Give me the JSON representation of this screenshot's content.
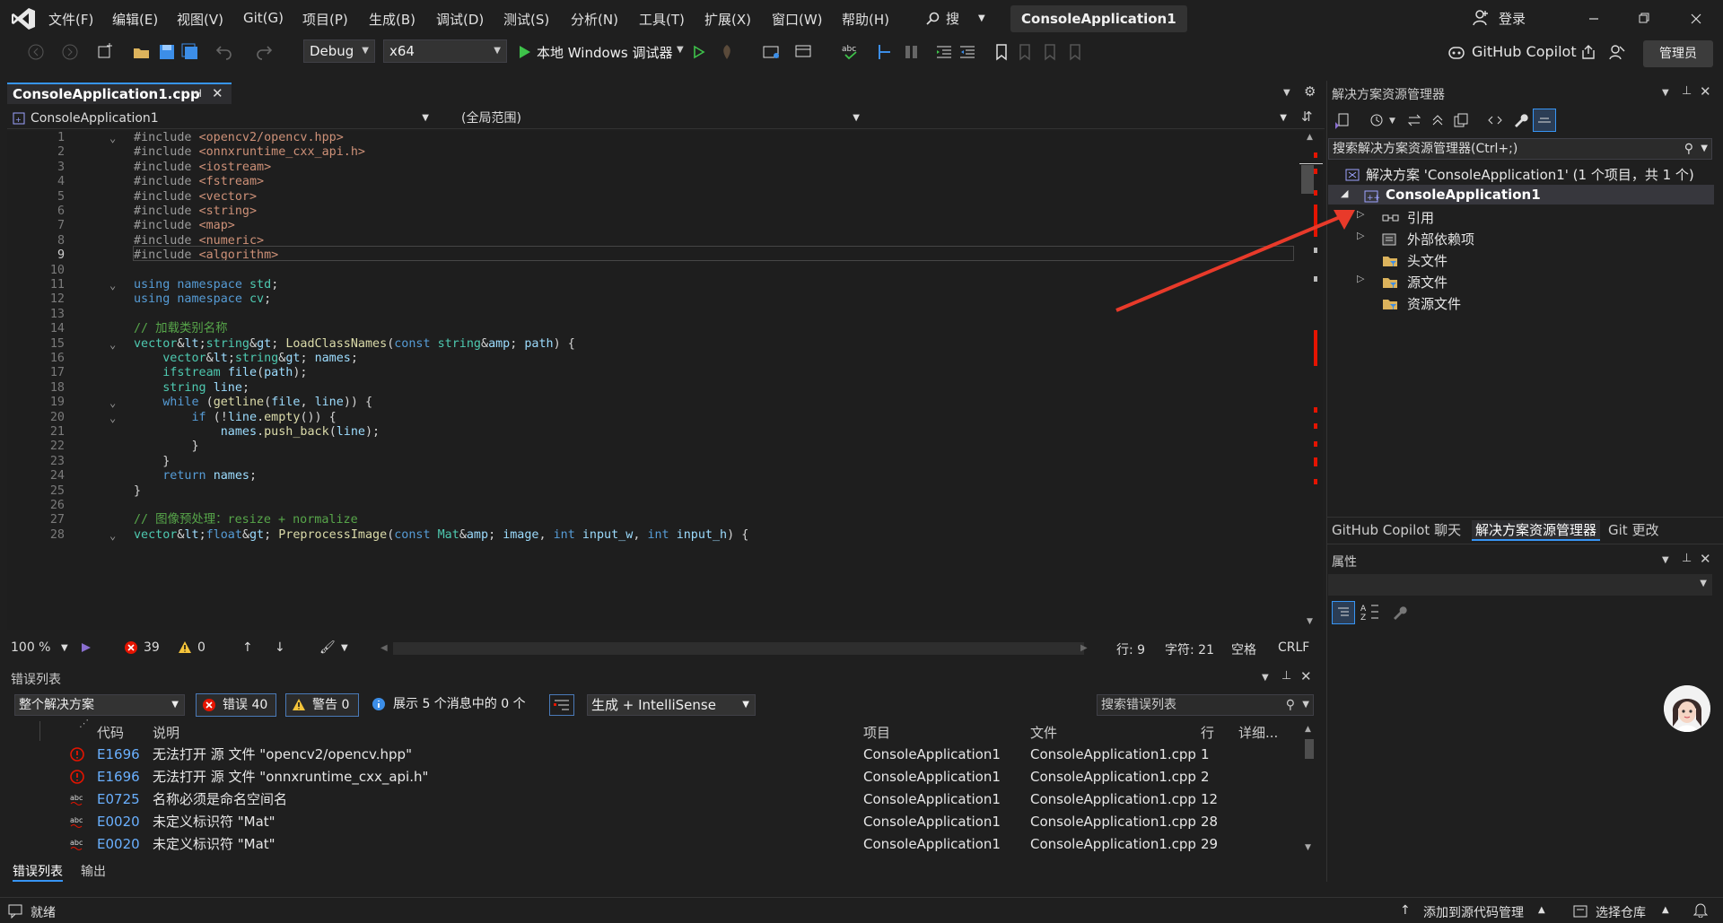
{
  "app": {
    "title": "ConsoleApplication1",
    "search_label": "搜索",
    "login_label": "登录"
  },
  "menu": [
    "文件(F)",
    "编辑(E)",
    "视图(V)",
    "Git(G)",
    "项目(P)",
    "生成(B)",
    "调试(D)",
    "测试(S)",
    "分析(N)",
    "工具(T)",
    "扩展(X)",
    "窗口(W)",
    "帮助(H)"
  ],
  "toolbar": {
    "config": "Debug",
    "platform": "x64",
    "run_label": "本地 Windows 调试器",
    "copilot_label": "GitHub Copilot",
    "admin_label": "管理员"
  },
  "editor": {
    "tab_label": "ConsoleApplication1.cpp",
    "nav_project": "ConsoleApplication1",
    "nav_scope": "(全局范围)",
    "current_line": 9,
    "lines": [
      {
        "n": "1",
        "t": "#include <opencv2/opencv.hpp>"
      },
      {
        "n": "2",
        "t": "#include <onnxruntime_cxx_api.h>"
      },
      {
        "n": "3",
        "t": "#include <iostream>"
      },
      {
        "n": "4",
        "t": "#include <fstream>"
      },
      {
        "n": "5",
        "t": "#include <vector>"
      },
      {
        "n": "6",
        "t": "#include <string>"
      },
      {
        "n": "7",
        "t": "#include <map>"
      },
      {
        "n": "8",
        "t": "#include <numeric>"
      },
      {
        "n": "9",
        "t": "#include <algorithm>"
      },
      {
        "n": "10",
        "t": ""
      },
      {
        "n": "11",
        "t": "using namespace std;"
      },
      {
        "n": "12",
        "t": "using namespace cv;"
      },
      {
        "n": "13",
        "t": ""
      },
      {
        "n": "14",
        "t": "// 加载类别名称"
      },
      {
        "n": "15",
        "t": "vector<string> LoadClassNames(const string& path) {"
      },
      {
        "n": "16",
        "t": "    vector<string> names;"
      },
      {
        "n": "17",
        "t": "    ifstream file(path);"
      },
      {
        "n": "18",
        "t": "    string line;"
      },
      {
        "n": "19",
        "t": "    while (getline(file, line)) {"
      },
      {
        "n": "20",
        "t": "        if (!line.empty()) {"
      },
      {
        "n": "21",
        "t": "            names.push_back(line);"
      },
      {
        "n": "22",
        "t": "        }"
      },
      {
        "n": "23",
        "t": "    }"
      },
      {
        "n": "24",
        "t": "    return names;"
      },
      {
        "n": "25",
        "t": "}"
      },
      {
        "n": "26",
        "t": ""
      },
      {
        "n": "27",
        "t": "// 图像预处理：resize + normalize"
      },
      {
        "n": "28",
        "t": "vector<float> PreprocessImage(const Mat& image, int input_w, int input_h) {"
      }
    ],
    "zoom": "100 %",
    "error_count": "39",
    "warning_count": "0",
    "row": "行: 9",
    "col": "字符: 21",
    "whitespace": "空格",
    "eol": "CRLF"
  },
  "errors": {
    "panel_title": "错误列表",
    "scope": "整个解决方案",
    "errors_btn": "错误 40",
    "warnings_btn": "警告 0",
    "messages_btn": "展示 5 个消息中的 0 个",
    "source": "生成 + IntelliSense",
    "search_placeholder": "搜索错误列表",
    "headers": {
      "code": "代码",
      "desc": "说明",
      "project": "项目",
      "file": "文件",
      "line": "行",
      "detail": "详细..."
    },
    "rows": [
      {
        "code": "E1696",
        "desc": "无法打开 源 文件 \"opencv2/opencv.hpp\"",
        "project": "ConsoleApplication1",
        "file": "ConsoleApplication1.cpp",
        "line": "1",
        "kind": "error"
      },
      {
        "code": "E1696",
        "desc": "无法打开 源 文件 \"onnxruntime_cxx_api.h\"",
        "project": "ConsoleApplication1",
        "file": "ConsoleApplication1.cpp",
        "line": "2",
        "kind": "error"
      },
      {
        "code": "E0725",
        "desc": "名称必须是命名空间名",
        "project": "ConsoleApplication1",
        "file": "ConsoleApplication1.cpp",
        "line": "12",
        "kind": "abc"
      },
      {
        "code": "E0020",
        "desc": "未定义标识符 \"Mat\"",
        "project": "ConsoleApplication1",
        "file": "ConsoleApplication1.cpp",
        "line": "28",
        "kind": "abc"
      },
      {
        "code": "E0020",
        "desc": "未定义标识符 \"Mat\"",
        "project": "ConsoleApplication1",
        "file": "ConsoleApplication1.cpp",
        "line": "29",
        "kind": "abc"
      }
    ],
    "tab_errors": "错误列表",
    "tab_output": "输出"
  },
  "solution": {
    "title": "解决方案资源管理器",
    "search_placeholder": "搜索解决方案资源管理器(Ctrl+;)",
    "solution_label": "解决方案 'ConsoleApplication1' (1 个项目，共 1 个)",
    "project_label": "ConsoleApplication1",
    "items": [
      "引用",
      "外部依赖项",
      "头文件",
      "源文件",
      "资源文件"
    ],
    "tab_copilot": "GitHub Copilot 聊天",
    "tab_solution": "解决方案资源管理器",
    "tab_git": "Git 更改"
  },
  "properties": {
    "title": "属性"
  },
  "status": {
    "ready": "就绪",
    "add_source": "添加到源代码管理",
    "select_repo": "选择仓库"
  },
  "colors": {
    "accent": "#3795f4",
    "error": "#e51400",
    "keyword": "#569cd6",
    "type": "#4ec9b0",
    "comment": "#57a64a"
  }
}
